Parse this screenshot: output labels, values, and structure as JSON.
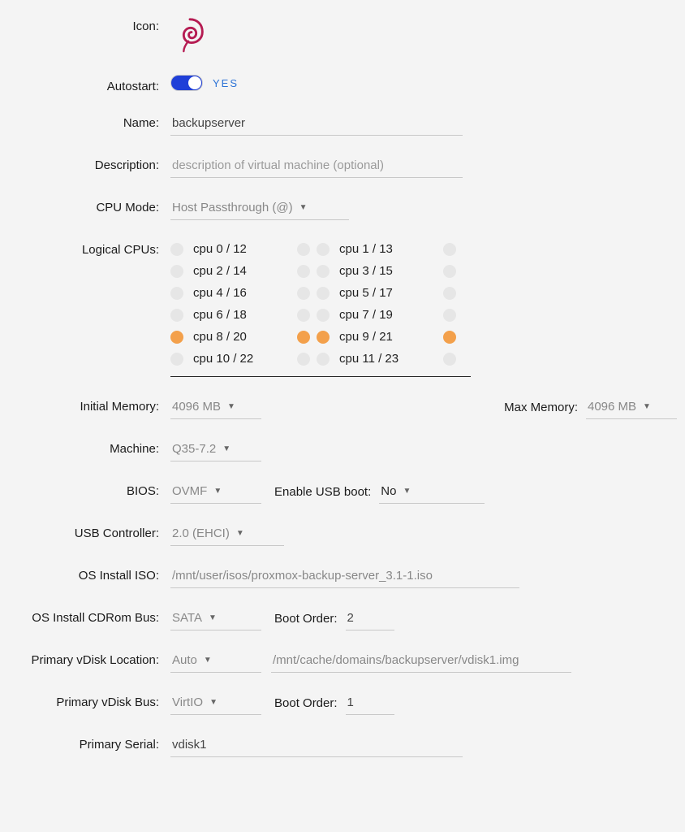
{
  "labels": {
    "icon": "Icon:",
    "autostart": "Autostart:",
    "name": "Name:",
    "description": "Description:",
    "cpu_mode": "CPU Mode:",
    "logical_cpus": "Logical CPUs:",
    "initial_memory": "Initial Memory:",
    "max_memory": "Max Memory:",
    "machine": "Machine:",
    "bios": "BIOS:",
    "enable_usb_boot": "Enable USB boot:",
    "usb_controller": "USB Controller:",
    "os_install_iso": "OS Install ISO:",
    "os_install_cdrom_bus": "OS Install CDRom Bus:",
    "boot_order": "Boot Order:",
    "primary_vdisk_location": "Primary vDisk Location:",
    "primary_vdisk_bus": "Primary vDisk Bus:",
    "primary_serial": "Primary Serial:"
  },
  "icon": {
    "name": "debian-swirl"
  },
  "autostart": {
    "value": true,
    "text": "YES"
  },
  "name": {
    "value": "backupserver"
  },
  "description": {
    "value": "",
    "placeholder": "description of virtual machine (optional)"
  },
  "cpu_mode": {
    "value": "Host Passthrough (@)"
  },
  "logical_cpus": [
    {
      "left": "cpu 0 / 12",
      "right": "cpu 1 / 13",
      "sel": false
    },
    {
      "left": "cpu 2 / 14",
      "right": "cpu 3 / 15",
      "sel": false
    },
    {
      "left": "cpu 4 / 16",
      "right": "cpu 5 / 17",
      "sel": false
    },
    {
      "left": "cpu 6 / 18",
      "right": "cpu 7 / 19",
      "sel": false
    },
    {
      "left": "cpu 8 / 20",
      "right": "cpu 9 / 21",
      "sel": true
    },
    {
      "left": "cpu 10 / 22",
      "right": "cpu 11 / 23",
      "sel": false
    }
  ],
  "initial_memory": {
    "value": "4096 MB"
  },
  "max_memory": {
    "value": "4096 MB"
  },
  "machine": {
    "value": "Q35-7.2"
  },
  "bios": {
    "value": "OVMF"
  },
  "enable_usb_boot": {
    "value": "No"
  },
  "usb_controller": {
    "value": "2.0 (EHCI)"
  },
  "os_install_iso": {
    "value": "/mnt/user/isos/proxmox-backup-server_3.1-1.iso"
  },
  "os_install_cdrom_bus": {
    "value": "SATA"
  },
  "cdrom_boot_order": {
    "value": "2"
  },
  "primary_vdisk_location": {
    "value": "Auto",
    "path": "/mnt/cache/domains/backupserver/vdisk1.img"
  },
  "primary_vdisk_bus": {
    "value": "VirtIO"
  },
  "vdisk_boot_order": {
    "value": "1"
  },
  "primary_serial": {
    "value": "vdisk1"
  }
}
